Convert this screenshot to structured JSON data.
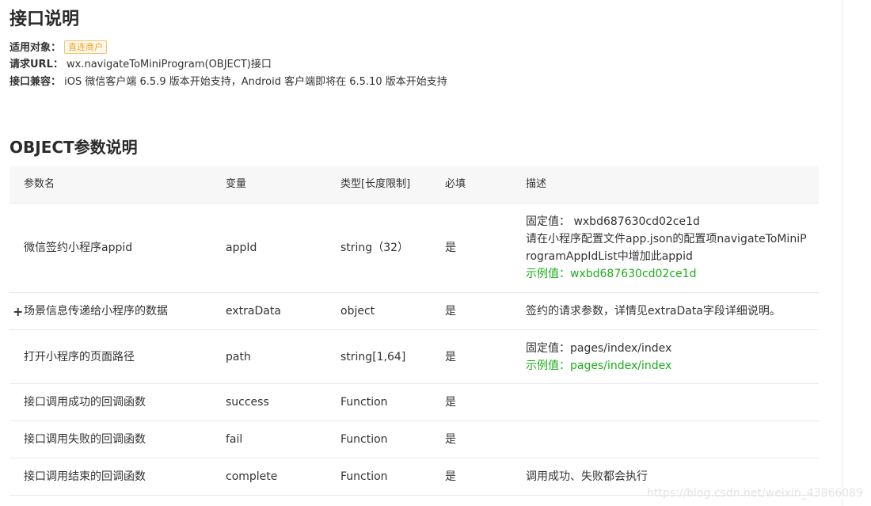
{
  "intro": {
    "title": "接口说明",
    "scope_label": "适用对象：",
    "scope_badge": "直连商户",
    "url_label": "请求URL：",
    "url_value": "wx.navigateToMiniProgram(OBJECT)接口",
    "compat_label": "接口兼容：",
    "compat_value": "iOS 微信客户端 6.5.9 版本开始支持，Android 客户端即将在 6.5.10 版本开始支持"
  },
  "params": {
    "title": "OBJECT参数说明",
    "headers": [
      "参数名",
      "变量",
      "类型[长度限制]",
      "必填",
      "描述"
    ],
    "rows": [
      {
        "name": "微信签约小程序appid",
        "var": "appId",
        "type": "string（32）",
        "required": "是",
        "desc": [
          "固定值： wxbd687630cd02ce1d",
          "请在小程序配置文件app.json的配置项navigateToMiniProgramAppIdList中增加此appid"
        ],
        "example": "示例值：wxbd687630cd02ce1d"
      },
      {
        "expand": "+",
        "name": "场景信息传递给小程序的数据",
        "var": "extraData",
        "type": "object",
        "required": "是",
        "desc": [
          "签约的请求参数，详情见extraData字段详细说明。"
        ],
        "example": ""
      },
      {
        "name": "打开小程序的页面路径",
        "var": "path",
        "type": "string[1,64]",
        "required": "是",
        "desc": [
          "固定值：pages/index/index"
        ],
        "example": "示例值：pages/index/index"
      },
      {
        "name": "接口调用成功的回调函数",
        "var": "success",
        "type": "Function",
        "required": "是",
        "desc": [],
        "example": ""
      },
      {
        "name": "接口调用失败的回调函数",
        "var": "fail",
        "type": "Function",
        "required": "是",
        "desc": [],
        "example": ""
      },
      {
        "name": "接口调用结束的回调函数",
        "var": "complete",
        "type": "Function",
        "required": "是",
        "desc": [
          "调用成功、失败都会执行"
        ],
        "example": ""
      }
    ]
  },
  "watermark": "https://blog.csdn.net/weixin_43866089"
}
